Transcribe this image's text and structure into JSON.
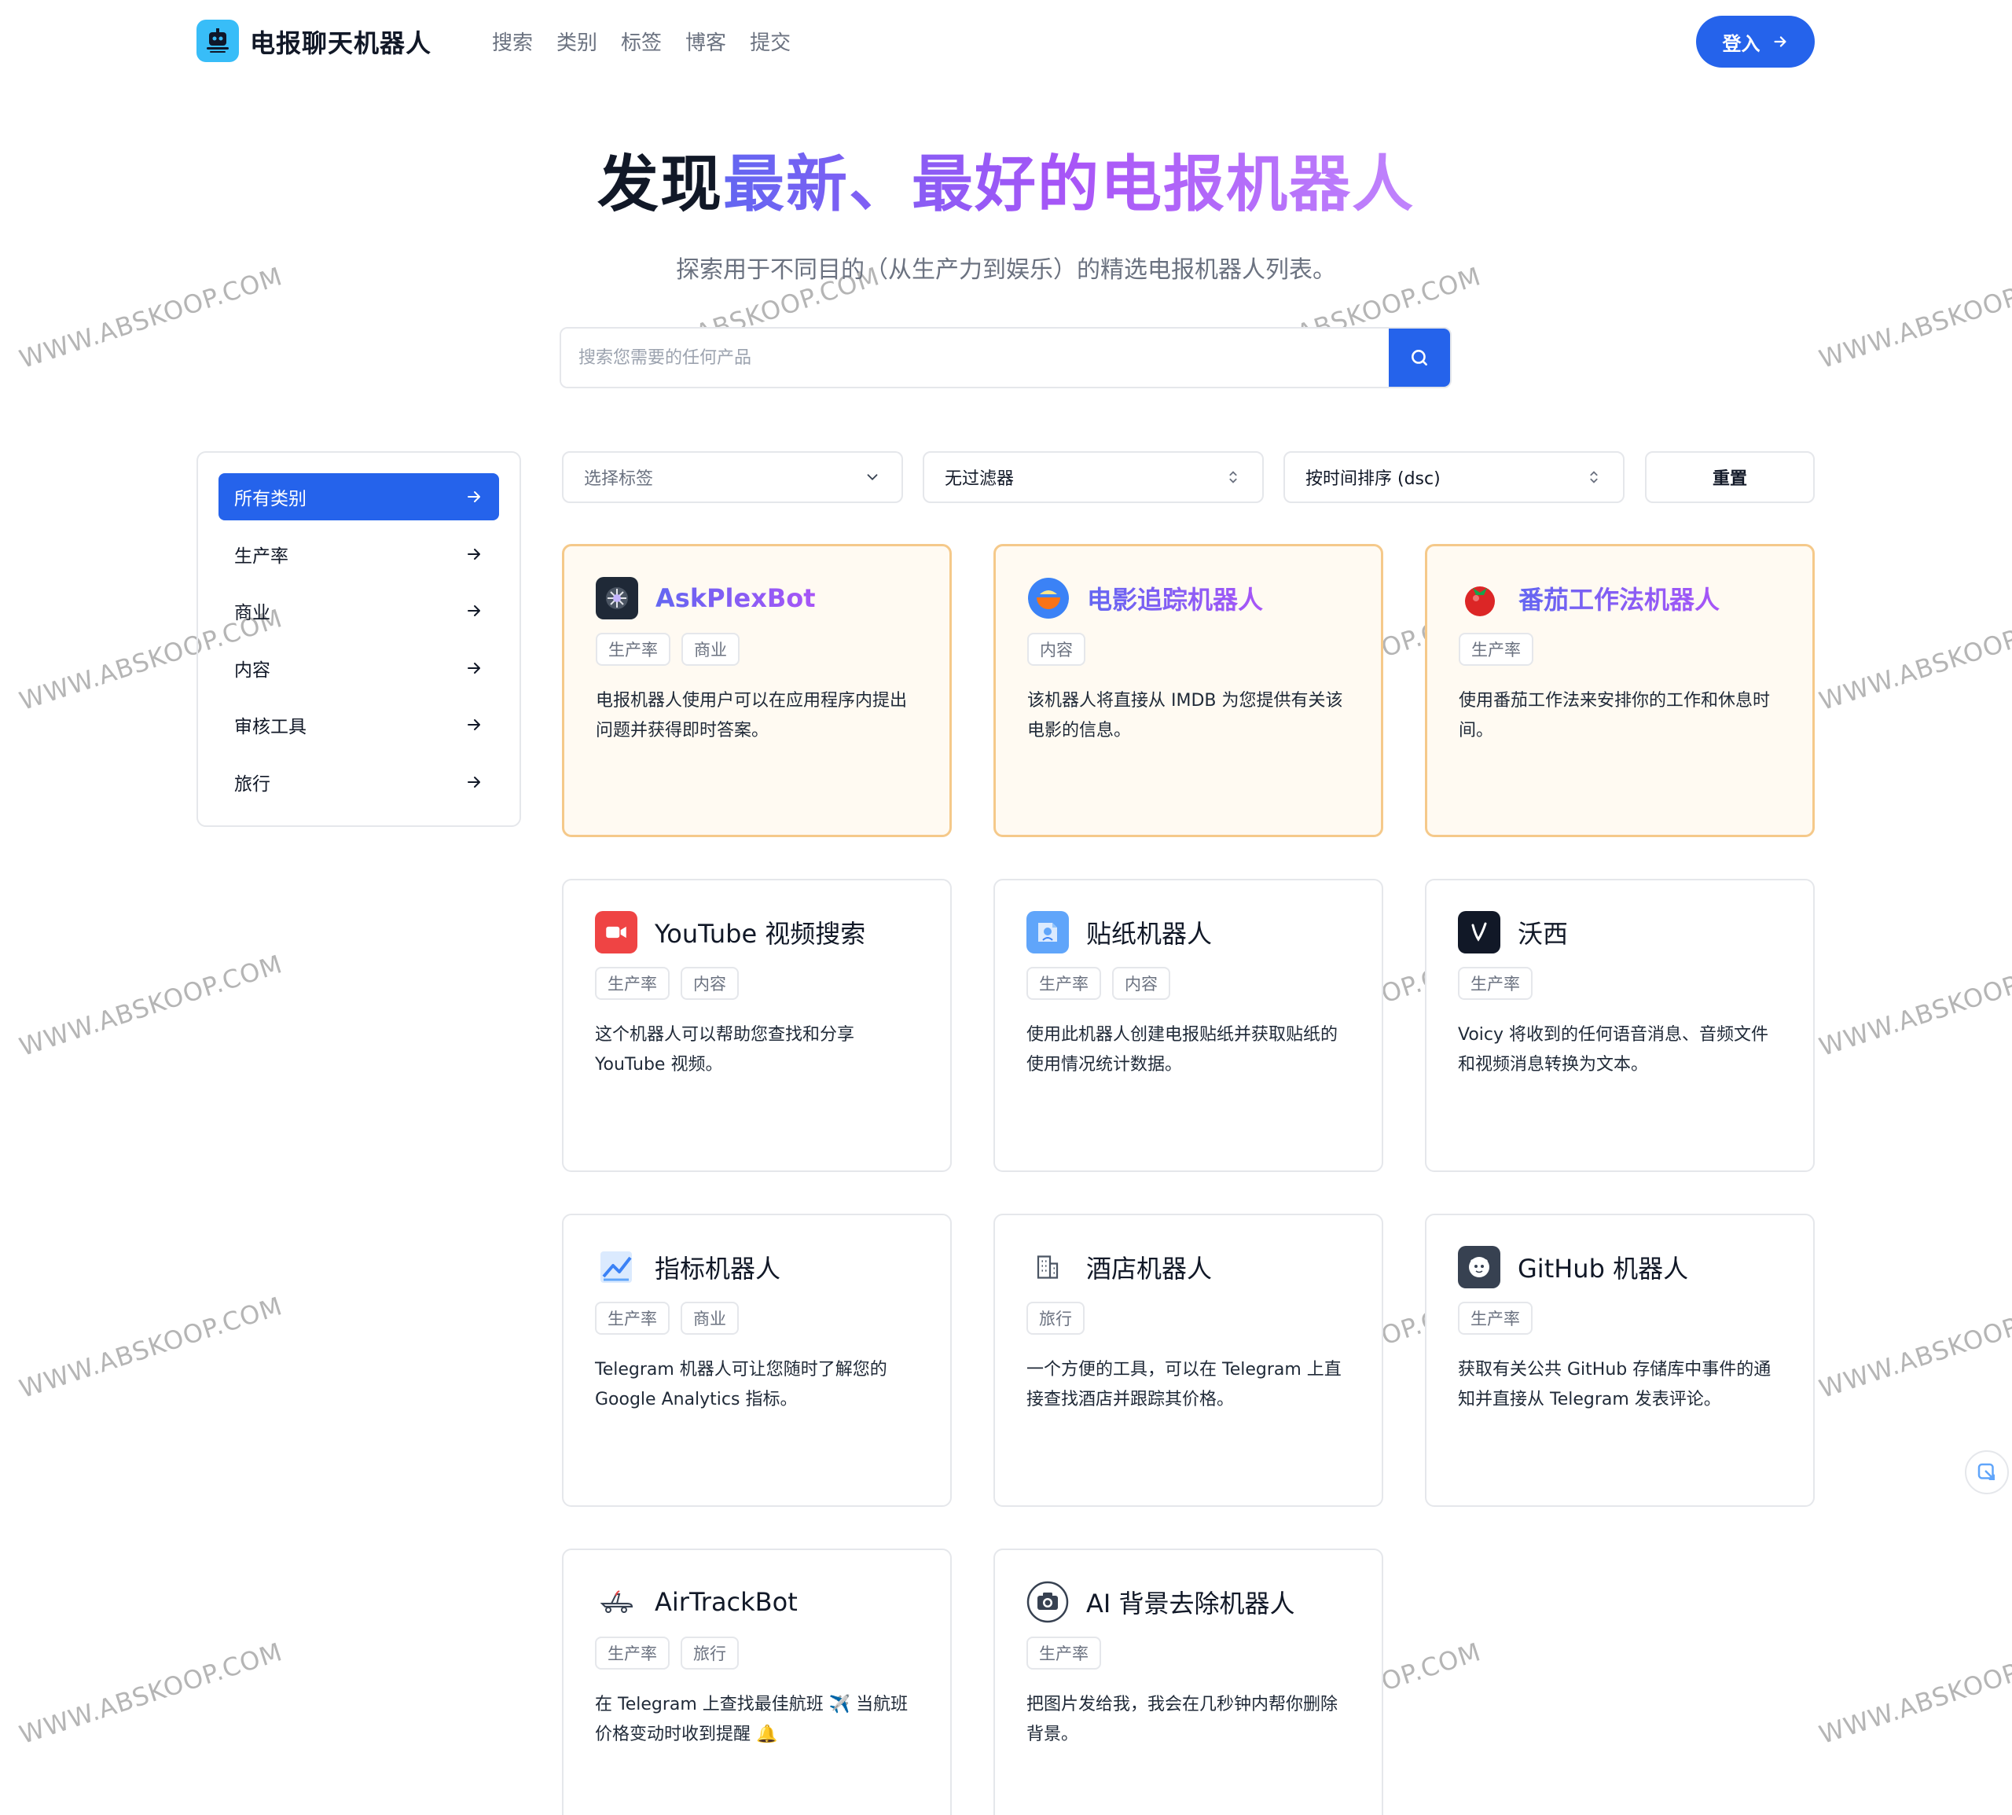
{
  "header": {
    "brand": "电报聊天机器人",
    "nav": [
      "搜索",
      "类别",
      "标签",
      "博客",
      "提交"
    ],
    "login_label": "登入"
  },
  "hero": {
    "title_plain": "发现",
    "title_gradient": "最新、最好的电报机器人",
    "subtitle": "探索用于不同目的（从生产力到娱乐）的精选电报机器人列表。"
  },
  "search": {
    "placeholder": "搜索您需要的任何产品"
  },
  "sidebar": {
    "items": [
      {
        "label": "所有类别",
        "active": true
      },
      {
        "label": "生产率"
      },
      {
        "label": "商业"
      },
      {
        "label": "内容"
      },
      {
        "label": "审核工具"
      },
      {
        "label": "旅行"
      }
    ]
  },
  "filters": {
    "tag_select": "选择标签",
    "filter_select": "无过滤器",
    "sort_select": "按时间排序 (dsc)",
    "reset": "重置"
  },
  "cards": [
    {
      "title": "AskPlexBot",
      "tags": [
        "生产率",
        "商业"
      ],
      "desc": "电报机器人使用户可以在应用程序内提出问题并获得即时答案。",
      "featured": true,
      "icon": "askplexbot-icon"
    },
    {
      "title": "电影追踪机器人",
      "tags": [
        "内容"
      ],
      "desc": "该机器人将直接从 IMDB 为您提供有关该电影的信息。",
      "featured": true,
      "icon": "movie-bowl-icon"
    },
    {
      "title": "番茄工作法机器人",
      "tags": [
        "生产率"
      ],
      "desc": "使用番茄工作法来安排你的工作和休息时间。",
      "featured": true,
      "icon": "tomato-icon"
    },
    {
      "title": "YouTube 视频搜索",
      "tags": [
        "生产率",
        "内容"
      ],
      "desc": "这个机器人可以帮助您查找和分享 YouTube 视频。",
      "icon": "video-camera-icon"
    },
    {
      "title": "贴纸机器人",
      "tags": [
        "生产率",
        "内容"
      ],
      "desc": "使用此机器人创建电报贴纸并获取贴纸的使用情况统计数据。",
      "icon": "sticker-icon"
    },
    {
      "title": "沃西",
      "tags": [
        "生产率"
      ],
      "desc": "Voicy 将收到的任何语音消息、音频文件和视频消息转换为文本。",
      "icon": "voicy-icon"
    },
    {
      "title": "指标机器人",
      "tags": [
        "生产率",
        "商业"
      ],
      "desc": "Telegram 机器人可让您随时了解您的 Google Analytics 指标。",
      "icon": "chart-trend-icon"
    },
    {
      "title": "酒店机器人",
      "tags": [
        "旅行"
      ],
      "desc": "一个方便的工具，可以在 Telegram 上直接查找酒店并跟踪其价格。",
      "icon": "hotel-building-icon"
    },
    {
      "title": "GitHub 机器人",
      "tags": [
        "生产率"
      ],
      "desc": "获取有关公共 GitHub 存储库中事件的通知并直接从 Telegram 发表评论。",
      "icon": "github-icon"
    },
    {
      "title": "AirTrackBot",
      "tags": [
        "生产率",
        "旅行"
      ],
      "desc": "在 Telegram 上查找最佳航班 ✈️ 当航班价格变动时收到提醒 🔔",
      "icon": "airplane-icon"
    },
    {
      "title": "AI 背景去除机器人",
      "tags": [
        "生产率"
      ],
      "desc": "把图片发给我，我会在几秒钟内帮你删除背景。",
      "icon": "camera-icon"
    }
  ],
  "watermark": "WWW.ABSKOOP.COM",
  "colors": {
    "accent": "#2563eb",
    "featured_border": "#f5c98a",
    "featured_bg": "#fffaf2",
    "gradient_start": "#6366f1",
    "gradient_end": "#a855f7"
  }
}
